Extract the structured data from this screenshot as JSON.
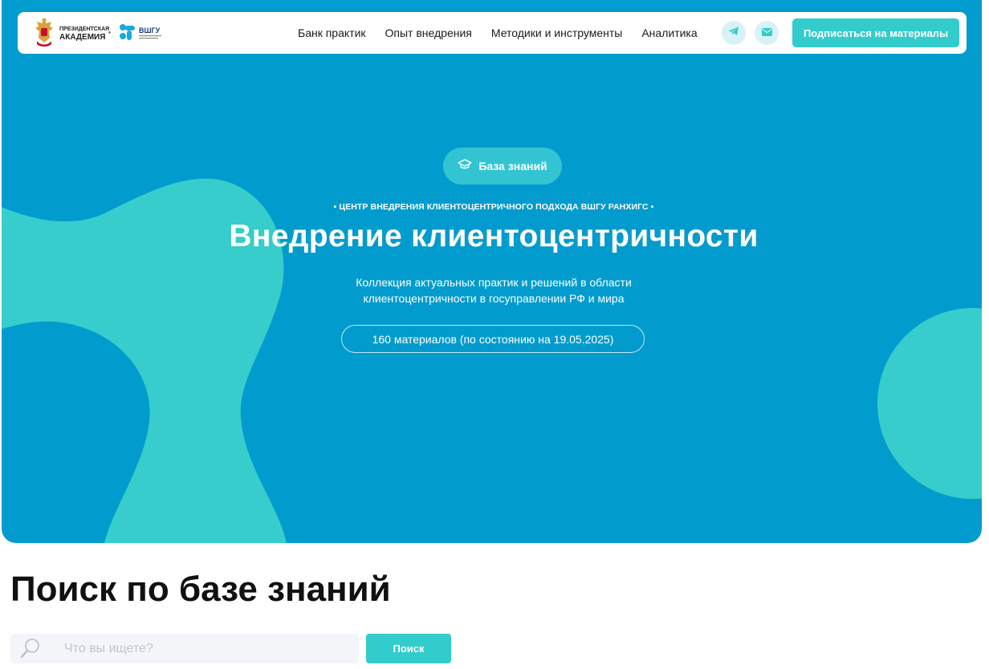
{
  "header": {
    "logo_academy_line1": "ПРЕЗИДЕНТСКАЯ",
    "logo_academy_line2": "АКАДЕМИЯ",
    "logo_vshgu": "ВШГУ",
    "nav": [
      {
        "label": "Банк практик"
      },
      {
        "label": "Опыт внедрения"
      },
      {
        "label": "Методики и инструменты"
      },
      {
        "label": "Аналитика"
      }
    ],
    "social_icons": [
      "telegram-icon",
      "mail-icon"
    ],
    "subscribe_label": "Подписаться на материалы"
  },
  "hero": {
    "badge_icon": "graduation-cap-icon",
    "badge_label": "База знаний",
    "eyebrow": "• ЦЕНТР ВНЕДРЕНИЯ КЛИЕНТОЦЕНТРИЧНОГО ПОДХОДА ВШГУ РАНХИГС •",
    "title": "Внедрение клиентоцентричности",
    "subtitle": "Коллекция актуальных практик и решений в области клиентоцентричности в госуправлении РФ и мира",
    "count": "160 материалов (по состоянию на 19.05.2025)"
  },
  "search": {
    "heading": "Поиск по базе знаний",
    "placeholder": "Что вы ищете?",
    "value": "",
    "button_label": "Поиск"
  },
  "colors": {
    "hero_bg": "#019ccd",
    "accent": "#33cccc",
    "blob": "#36cdcc"
  }
}
